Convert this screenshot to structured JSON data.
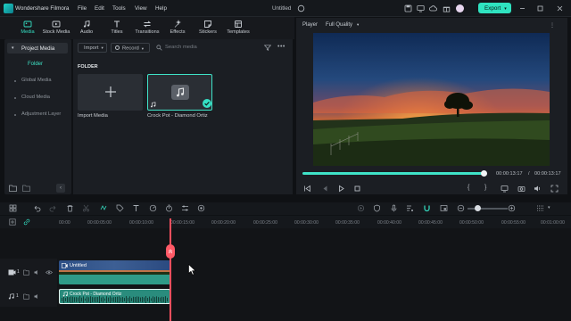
{
  "app": {
    "name": "Wondershare Filmora",
    "doc_title": "Untitled",
    "export_label": "Export"
  },
  "menu": [
    "File",
    "Edit",
    "Tools",
    "View",
    "Help"
  ],
  "tabs": [
    {
      "label": "Media",
      "icon": "media-icon",
      "active": true
    },
    {
      "label": "Stock Media",
      "icon": "stock-media-icon",
      "active": false
    },
    {
      "label": "Audio",
      "icon": "audio-icon",
      "active": false
    },
    {
      "label": "Titles",
      "icon": "titles-icon",
      "active": false
    },
    {
      "label": "Transitions",
      "icon": "transitions-icon",
      "active": false
    },
    {
      "label": "Effects",
      "icon": "effects-icon",
      "active": false
    },
    {
      "label": "Stickers",
      "icon": "stickers-icon",
      "active": false
    },
    {
      "label": "Templates",
      "icon": "templates-icon",
      "active": false
    }
  ],
  "sidebar": {
    "head": "Project Media",
    "folder": "Folder",
    "items": [
      "Global Media",
      "Cloud Media",
      "Adjustment Layer"
    ]
  },
  "media": {
    "import_label": "Import",
    "record_label": "Record",
    "search_placeholder": "Search media",
    "folder_label": "FOLDER",
    "tiles": [
      {
        "label": "Import Media"
      },
      {
        "label": "Crock Pot - Diamond Ortiz"
      }
    ]
  },
  "preview": {
    "player_label": "Player",
    "quality": "Full Quality",
    "current_time": "00:00:13:17",
    "separator": "/",
    "total_time": "00:00:13:17",
    "progress": 1.0
  },
  "timeline": {
    "ticks": [
      "00:00",
      "00:00:05:00",
      "00:00:10:00",
      "00:00:15:00",
      "00:00:20:00",
      "00:00:25:00",
      "00:00:30:00",
      "00:00:35:00",
      "00:00:40:00",
      "00:00:45:00",
      "00:00:50:00",
      "00:00:55:00",
      "00:01:00:00"
    ],
    "video_clip_label": "Untitled",
    "audio_clip_label": "Crock Pot - Diamond Ortiz"
  },
  "colors": {
    "accent": "#2fe3c0",
    "playhead": "#ff4f5e",
    "audio_clip": "#2a8c7d"
  }
}
